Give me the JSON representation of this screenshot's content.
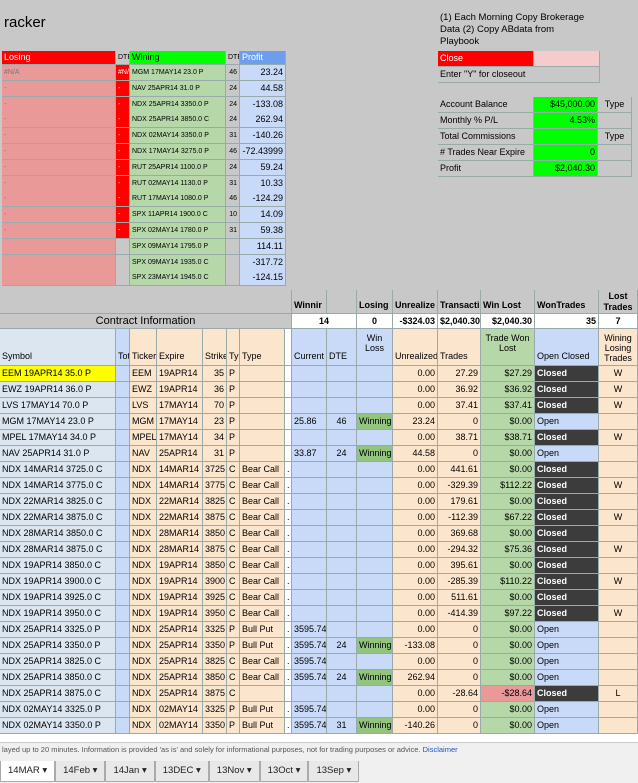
{
  "title": "racker",
  "notes": [
    "(1) Each Morning Copy Brokerage",
    "Data (2) Copy ABdata from",
    "Playbook"
  ],
  "close_label": "Close",
  "closeout_hint": "Enter \"Y\" for closeout",
  "summary": [
    {
      "label": "Account Balance",
      "value": "$45,000.00",
      "extra": "Type"
    },
    {
      "label": "Monthly % P/L",
      "value": "4.53%",
      "extra": ""
    },
    {
      "label": "Total Commissions",
      "value": "",
      "extra": "Type"
    },
    {
      "label": "# Trades Near Expire",
      "value": "0",
      "extra": ""
    },
    {
      "label": "Profit",
      "value": "$2,040.30",
      "extra": ""
    }
  ],
  "mini": {
    "headers": {
      "losing": "Losing",
      "dte1": "DTE",
      "wining": "Wining",
      "dte2": "DTE",
      "profit": "Profit"
    },
    "rows": [
      {
        "l": "#N/A",
        "d1": "#N/A",
        "w": "MGM 17MAY14 23.0 P",
        "d2": "46",
        "p": "23.24"
      },
      {
        "l": "-",
        "d1": "-",
        "w": "NAV 25APR14 31.0 P",
        "d2": "24",
        "p": "44.58"
      },
      {
        "l": "-",
        "d1": "-",
        "w": "NDX 25APR14 3350.0 P",
        "d2": "24",
        "p": "-133.08"
      },
      {
        "l": "-",
        "d1": "-",
        "w": "NDX 25APR14 3850.0 C",
        "d2": "24",
        "p": "262.94"
      },
      {
        "l": "-",
        "d1": "-",
        "w": "NDX 02MAY14 3350.0 P",
        "d2": "31",
        "p": "-140.26"
      },
      {
        "l": "-",
        "d1": "-",
        "w": "NDX 17MAY14 3275.0 P",
        "d2": "46",
        "p": "-72.43999"
      },
      {
        "l": "-",
        "d1": "-",
        "w": "RUT 25APR14 1100.0 P",
        "d2": "24",
        "p": "59.24"
      },
      {
        "l": "-",
        "d1": "-",
        "w": "RUT 02MAY14 1130.0 P",
        "d2": "31",
        "p": "10.33"
      },
      {
        "l": "-",
        "d1": "-",
        "w": "RUT 17MAY14 1080.0 P",
        "d2": "46",
        "p": "-124.29"
      },
      {
        "l": "-",
        "d1": "-",
        "w": "SPX 11APR14 1900.0 C",
        "d2": "10",
        "p": "14.09"
      },
      {
        "l": "-",
        "d1": "-",
        "w": "SPX 02MAY14 1780.0 P",
        "d2": "31",
        "p": "59.38"
      },
      {
        "l": "",
        "d1": "",
        "w": "SPX 09MAY14 1795.0 P",
        "d2": "",
        "p": "114.11"
      },
      {
        "l": "",
        "d1": "",
        "w": "SPX 09MAY14 1935.0 C",
        "d2": "",
        "p": "-317.72"
      },
      {
        "l": "",
        "d1": "",
        "w": "SPX 23MAY14 1945.0 C",
        "d2": "",
        "p": "-124.15"
      }
    ]
  },
  "header_row1": {
    "winning": "Winnir",
    "losing": "Losing",
    "unrealized": "Unrealize",
    "transact": "Transacti",
    "winlost": "Win Lost",
    "wontrades": "WonTrades",
    "losttrades": "Lost Trades"
  },
  "header_row2": {
    "section": "Contract Information",
    "winning": "14",
    "losing": "0",
    "unrealized": "-$324.03",
    "transact": "$2,040.30",
    "winlost": "$2,040.30",
    "wontrades": "35",
    "losttrades": "7"
  },
  "col_headers": {
    "symbol": "Symbol",
    "tot": "Tot",
    "ticker": "Ticker",
    "expire": "Expire",
    "strike": "Strike",
    "typ": "Typ",
    "type": "Type",
    "current": "Current",
    "dte": "DTE",
    "winloss": "Win Loss",
    "unrealized": "Unrealized",
    "trades": "Trades",
    "tradewonlost": "Trade Won Lost",
    "openclosed": "Open Closed",
    "winninglosing": "Wining Losing Trades"
  },
  "trades": [
    {
      "sym": "EEM 19APR14 35.0 P",
      "t": "EEM",
      "e": "19APR14",
      "s": "35",
      "k": "P",
      "ty": "",
      "cur": "",
      "dte": "",
      "wl": "",
      "u": "0.00",
      "tr": "27.29",
      "twl": "$27.29",
      "st": "Closed",
      "wlt": "W"
    },
    {
      "sym": "EWZ 19APR14 36.0 P",
      "t": "EWZ",
      "e": "19APR14",
      "s": "36",
      "k": "P",
      "ty": "",
      "cur": "",
      "dte": "",
      "wl": "",
      "u": "0.00",
      "tr": "36.92",
      "twl": "$36.92",
      "st": "Closed",
      "wlt": "W"
    },
    {
      "sym": "LVS 17MAY14 70.0 P",
      "t": "LVS",
      "e": "17MAY14",
      "s": "70",
      "k": "P",
      "ty": "",
      "cur": "",
      "dte": "",
      "wl": "",
      "u": "0.00",
      "tr": "37.41",
      "twl": "$37.41",
      "st": "Closed",
      "wlt": "W"
    },
    {
      "sym": "MGM 17MAY14 23.0 P",
      "t": "MGM",
      "e": "17MAY14",
      "s": "23",
      "k": "P",
      "ty": "",
      "cur": "25.86",
      "dte": "46",
      "wl": "Winning",
      "u": "23.24",
      "tr": "0",
      "twl": "$0.00",
      "st": "Open",
      "wlt": ""
    },
    {
      "sym": "MPEL 17MAY14 34.0 P",
      "t": "MPEL",
      "e": "17MAY14",
      "s": "34",
      "k": "P",
      "ty": "",
      "cur": "",
      "dte": "",
      "wl": "",
      "u": "0.00",
      "tr": "38.71",
      "twl": "$38.71",
      "st": "Closed",
      "wlt": "W"
    },
    {
      "sym": "NAV 25APR14 31.0 P",
      "t": "NAV",
      "e": "25APR14",
      "s": "31",
      "k": "P",
      "ty": "",
      "cur": "33.87",
      "dte": "24",
      "wl": "Winning",
      "u": "44.58",
      "tr": "0",
      "twl": "$0.00",
      "st": "Open",
      "wlt": ""
    },
    {
      "sym": "NDX 14MAR14 3725.0 C",
      "t": "NDX",
      "e": "14MAR14",
      "s": "3725",
      "k": "C",
      "ty": "Bear Call",
      "cur": "",
      "dte": "",
      "wl": "",
      "u": "0.00",
      "tr": "441.61",
      "twl": "$0.00",
      "st": "Closed",
      "wlt": ""
    },
    {
      "sym": "NDX 14MAR14 3775.0 C",
      "t": "NDX",
      "e": "14MAR14",
      "s": "3775",
      "k": "C",
      "ty": "Bear Call",
      "cur": "",
      "dte": "",
      "wl": "",
      "u": "0.00",
      "tr": "-329.39",
      "twl": "$112.22",
      "st": "Closed",
      "wlt": "W"
    },
    {
      "sym": "NDX 22MAR14 3825.0 C",
      "t": "NDX",
      "e": "22MAR14",
      "s": "3825",
      "k": "C",
      "ty": "Bear Call",
      "cur": "",
      "dte": "",
      "wl": "",
      "u": "0.00",
      "tr": "179.61",
      "twl": "$0.00",
      "st": "Closed",
      "wlt": ""
    },
    {
      "sym": "NDX 22MAR14 3875.0 C",
      "t": "NDX",
      "e": "22MAR14",
      "s": "3875",
      "k": "C",
      "ty": "Bear Call",
      "cur": "",
      "dte": "",
      "wl": "",
      "u": "0.00",
      "tr": "-112.39",
      "twl": "$67.22",
      "st": "Closed",
      "wlt": "W"
    },
    {
      "sym": "NDX 28MAR14 3850.0 C",
      "t": "NDX",
      "e": "28MAR14",
      "s": "3850",
      "k": "C",
      "ty": "Bear Call",
      "cur": "",
      "dte": "",
      "wl": "",
      "u": "0.00",
      "tr": "369.68",
      "twl": "$0.00",
      "st": "Closed",
      "wlt": ""
    },
    {
      "sym": "NDX 28MAR14 3875.0 C",
      "t": "NDX",
      "e": "28MAR14",
      "s": "3875",
      "k": "C",
      "ty": "Bear Call",
      "cur": "",
      "dte": "",
      "wl": "",
      "u": "0.00",
      "tr": "-294.32",
      "twl": "$75.36",
      "st": "Closed",
      "wlt": "W"
    },
    {
      "sym": "NDX 19APR14 3850.0 C",
      "t": "NDX",
      "e": "19APR14",
      "s": "3850",
      "k": "C",
      "ty": "Bear Call",
      "cur": "",
      "dte": "",
      "wl": "",
      "u": "0.00",
      "tr": "395.61",
      "twl": "$0.00",
      "st": "Closed",
      "wlt": ""
    },
    {
      "sym": "NDX 19APR14 3900.0 C",
      "t": "NDX",
      "e": "19APR14",
      "s": "3900",
      "k": "C",
      "ty": "Bear Call",
      "cur": "",
      "dte": "",
      "wl": "",
      "u": "0.00",
      "tr": "-285.39",
      "twl": "$110.22",
      "st": "Closed",
      "wlt": "W"
    },
    {
      "sym": "NDX 19APR14 3925.0 C",
      "t": "NDX",
      "e": "19APR14",
      "s": "3925",
      "k": "C",
      "ty": "Bear Call",
      "cur": "",
      "dte": "",
      "wl": "",
      "u": "0.00",
      "tr": "511.61",
      "twl": "$0.00",
      "st": "Closed",
      "wlt": ""
    },
    {
      "sym": "NDX 19APR14 3950.0 C",
      "t": "NDX",
      "e": "19APR14",
      "s": "3950",
      "k": "C",
      "ty": "Bear Call",
      "cur": "",
      "dte": "",
      "wl": "",
      "u": "0.00",
      "tr": "-414.39",
      "twl": "$97.22",
      "st": "Closed",
      "wlt": "W"
    },
    {
      "sym": "NDX 25APR14 3325.0 P",
      "t": "NDX",
      "e": "25APR14",
      "s": "3325",
      "k": "P",
      "ty": "Bull Put",
      "cur": "3595.74",
      "dte": "",
      "wl": "",
      "u": "0.00",
      "tr": "0",
      "twl": "$0.00",
      "st": "Open",
      "wlt": ""
    },
    {
      "sym": "NDX 25APR14 3350.0 P",
      "t": "NDX",
      "e": "25APR14",
      "s": "3350",
      "k": "P",
      "ty": "Bull Put",
      "cur": "3595.74",
      "dte": "24",
      "wl": "Winning",
      "u": "-133.08",
      "tr": "0",
      "twl": "$0.00",
      "st": "Open",
      "wlt": ""
    },
    {
      "sym": "NDX 25APR14 3825.0 C",
      "t": "NDX",
      "e": "25APR14",
      "s": "3825",
      "k": "C",
      "ty": "Bear Call",
      "cur": "3595.74",
      "dte": "",
      "wl": "",
      "u": "0.00",
      "tr": "0",
      "twl": "$0.00",
      "st": "Open",
      "wlt": ""
    },
    {
      "sym": "NDX 25APR14 3850.0 C",
      "t": "NDX",
      "e": "25APR14",
      "s": "3850",
      "k": "C",
      "ty": "Bear Call",
      "cur": "3595.74",
      "dte": "24",
      "wl": "Winning",
      "u": "262.94",
      "tr": "0",
      "twl": "$0.00",
      "st": "Open",
      "wlt": ""
    },
    {
      "sym": "NDX 25APR14 3875.0 C",
      "t": "NDX",
      "e": "25APR14",
      "s": "3875",
      "k": "C",
      "ty": "",
      "cur": "",
      "dte": "",
      "wl": "",
      "u": "0.00",
      "tr": "-28.64",
      "twl": "-$28.64",
      "st": "Closed",
      "wlt": "L"
    },
    {
      "sym": "NDX 02MAY14 3325.0 P",
      "t": "NDX",
      "e": "02MAY14",
      "s": "3325",
      "k": "P",
      "ty": "Bull Put",
      "cur": "3595.74",
      "dte": "",
      "wl": "",
      "u": "0.00",
      "tr": "0",
      "twl": "$0.00",
      "st": "Open",
      "wlt": ""
    },
    {
      "sym": "NDX 02MAY14 3350.0 P",
      "t": "NDX",
      "e": "02MAY14",
      "s": "3350",
      "k": "P",
      "ty": "Bull Put",
      "cur": "3595.74",
      "dte": "31",
      "wl": "Winning",
      "u": "-140.26",
      "tr": "0",
      "twl": "$0.00",
      "st": "Open",
      "wlt": ""
    }
  ],
  "disclaimer": "layed up to 20 minutes. Information is provided 'as is' and solely for informational purposes, not for trading purposes or advice.",
  "disclaimer_link": "Disclaimer",
  "tabs": [
    {
      "label": "14MAR",
      "active": true
    },
    {
      "label": "14Feb",
      "active": false
    },
    {
      "label": "14Jan",
      "active": false
    },
    {
      "label": "13DEC",
      "active": false
    },
    {
      "label": "13Nov",
      "active": false
    },
    {
      "label": "13Oct",
      "active": false
    },
    {
      "label": "13Sep",
      "active": false
    }
  ],
  "colors": {
    "losing_red": "#ff0000",
    "pink": "#ea9999",
    "winning_green": "#00ff00",
    "light_green": "#b6d7a8",
    "profit_blue": "#6d9eeb",
    "light_blue": "#c9daf8",
    "tan": "#fce5cd",
    "yellow": "#ffe599",
    "winning_cell": "#93c47d",
    "closed_dark": "#3c3c3c",
    "gray": "#c8c8c8",
    "summary_green": "#00ff00"
  }
}
